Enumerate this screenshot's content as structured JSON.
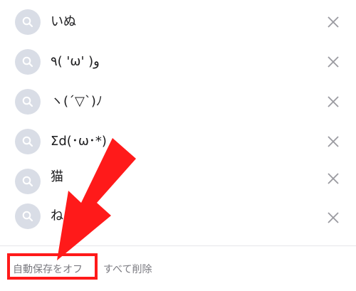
{
  "history": {
    "items": [
      {
        "label": "いぬ"
      },
      {
        "label": "٩( 'ω' )و"
      },
      {
        "label": "ヽ(´▽`)ﾉ"
      },
      {
        "label": "Σd(･ω･*)"
      },
      {
        "label": "猫"
      },
      {
        "label": "ね"
      }
    ]
  },
  "footer": {
    "autosave_off_label": "自動保存をオフ",
    "delete_all_label": "すべて削除"
  },
  "colors": {
    "annotation_red": "#ff1a1a",
    "icon_badge": "#d9dde6"
  },
  "icons": {
    "row_leading": "search-icon",
    "row_trailing": "close-icon"
  }
}
